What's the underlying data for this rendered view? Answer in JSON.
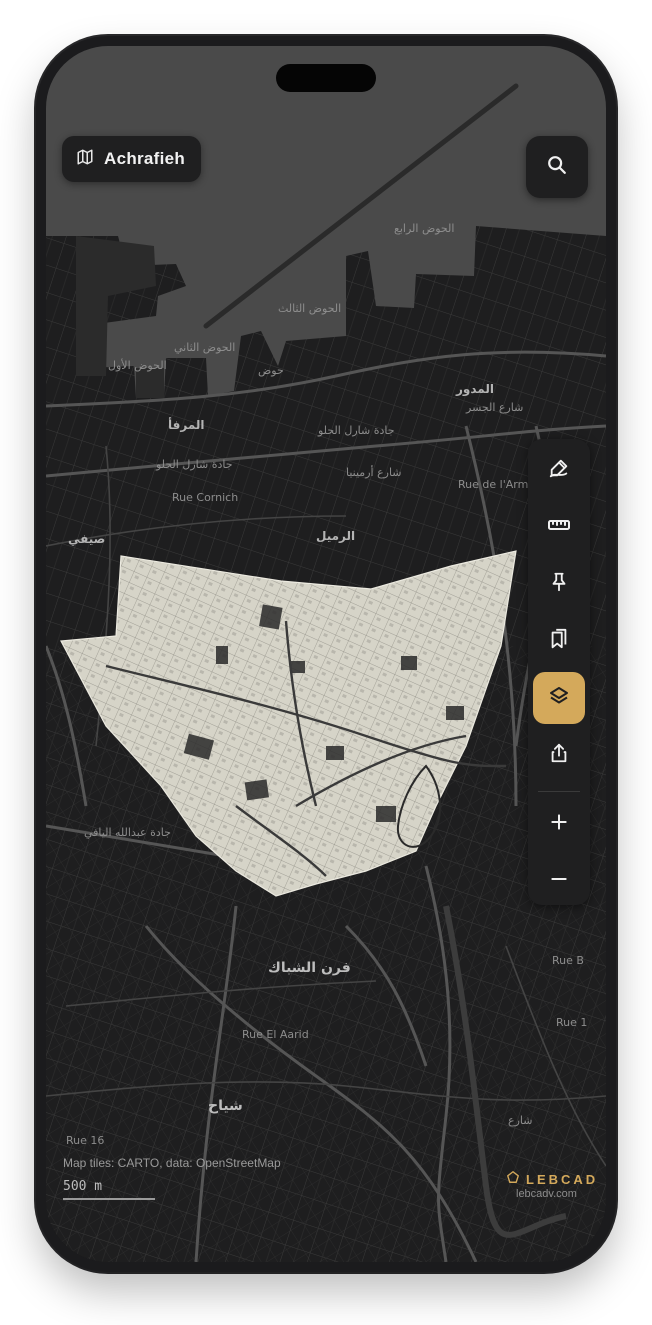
{
  "location_chip": {
    "label": "Achrafieh",
    "icon": "map-icon"
  },
  "search_button": {
    "icon": "search-icon"
  },
  "toolbar": {
    "tools": [
      {
        "name": "draw",
        "icon": "pen-draw-icon",
        "active": false
      },
      {
        "name": "measure",
        "icon": "ruler-icon",
        "active": false
      },
      {
        "name": "pin",
        "icon": "pushpin-icon",
        "active": false
      },
      {
        "name": "bookmarks",
        "icon": "bookmarks-icon",
        "active": false
      },
      {
        "name": "layers",
        "icon": "layers-icon",
        "active": true
      },
      {
        "name": "share",
        "icon": "share-icon",
        "active": false
      },
      {
        "name": "zoom-in",
        "icon": "plus-icon",
        "active": false
      },
      {
        "name": "zoom-out",
        "icon": "minus-icon",
        "active": false
      }
    ]
  },
  "map": {
    "labels": {
      "basin1": "الحوض الرابع",
      "basin2": "الحوض الثالث",
      "basin3": "الحوض الثاني",
      "basin4": "الحوض الأول",
      "dock": "حوض",
      "marfa": "المرفأ",
      "charles_helou": "جادة شارل الحلو",
      "charles_helou2": "جادة شارل الحلو",
      "rue_cornich": "Rue Cornich",
      "rmeil": "الرميل",
      "mdawar": "المدور",
      "armenia_ar": "شارع أرمينيا",
      "rue_armenie": "Rue de l'Arménie",
      "jisr_wati": "شارع الجسر",
      "saifi": "صيفي",
      "abdallah_yafi": "جادة عبدالله اليافي",
      "furn_chebbak": "فرن الشباك",
      "rue_el_aarid": "Rue El Aarid",
      "chiyah": "شياح",
      "rue_b": "Rue B",
      "rue_1": "Rue 1",
      "rue_16": "Rue 16",
      "sharik_b": "شارع"
    },
    "highlighted_area": "Achrafieh",
    "colors": {
      "background": "#1e1e1f",
      "sea": "#4a4a4a",
      "roads": "#4d4d4d",
      "highlight": "#d6d4c8",
      "accent": "#d4a95b"
    }
  },
  "attribution": "Map tiles: CARTO, data: OpenStreetMap",
  "scale": {
    "label": "500 m"
  },
  "brand": {
    "name": "LEBCAD",
    "url": "lebcadv.com",
    "icon": "pentagon-logo-icon"
  }
}
